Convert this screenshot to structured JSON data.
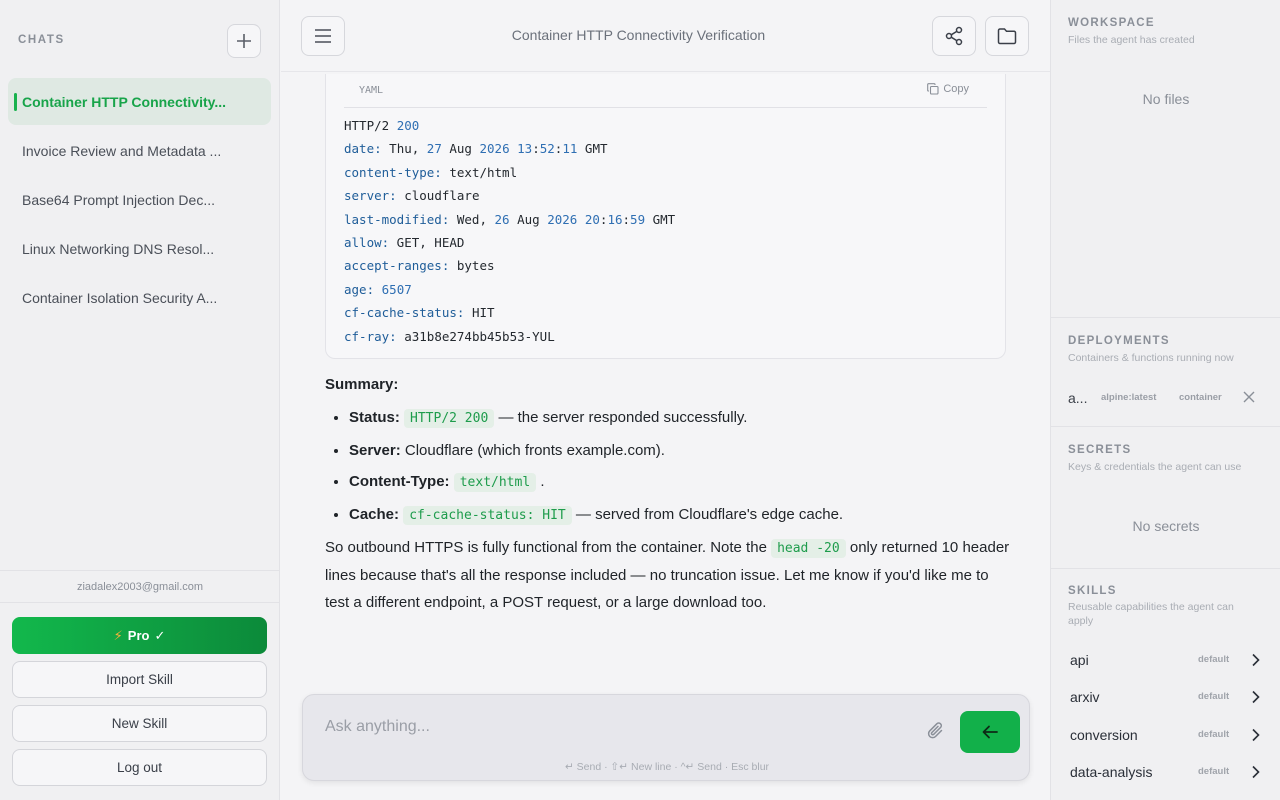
{
  "sidebar": {
    "heading": "CHATS",
    "chats": [
      {
        "label": "Container HTTP Connectivity...",
        "active": true
      },
      {
        "label": "Invoice Review and Metadata ...",
        "active": false
      },
      {
        "label": "Base64 Prompt Injection Dec...",
        "active": false
      },
      {
        "label": "Linux Networking DNS Resol...",
        "active": false
      },
      {
        "label": "Container Isolation Security A...",
        "active": false
      }
    ],
    "email": "ziadalex2003@gmail.com",
    "pro_label": "Pro",
    "pro_check": "✓",
    "import_label": "Import Skill",
    "new_skill_label": "New Skill",
    "logout_label": "Log out"
  },
  "header": {
    "title": "Container HTTP Connectivity Verification"
  },
  "code": {
    "lang": "YAML",
    "copy_label": "Copy",
    "lines": [
      "HTTP/2 200",
      "date: Thu, 27 Aug 2026 13:52:11 GMT",
      "content-type: text/html",
      "server: cloudflare",
      "last-modified: Wed, 26 Aug 2026 20:16:59 GMT",
      "allow: GET, HEAD",
      "accept-ranges: bytes",
      "age: 6507",
      "cf-cache-status: HIT",
      "cf-ray: a31b8e274bb45b53-YUL"
    ]
  },
  "answer": {
    "summary_heading": "Summary:",
    "bullets": [
      {
        "label": "Status:",
        "code": "HTTP/2 200",
        "text": " — the server responded successfully."
      },
      {
        "label": "Server:",
        "code": "",
        "text": " Cloudflare (which fronts example.com)."
      },
      {
        "label": "Content-Type:",
        "code": "text/html",
        "text": " ."
      },
      {
        "label": "Cache:",
        "code": "cf-cache-status: HIT",
        "text": " — served from Cloudflare's edge cache."
      }
    ],
    "para_before": "So outbound HTTPS is fully functional from the container. Note the ",
    "para_code": "head -20",
    "para_after": " only returned 10 header lines because that's all the response included — no truncation issue. Let me know if you'd like me to test a different endpoint, a POST request, or a large download too."
  },
  "composer": {
    "placeholder": "Ask anything...",
    "hints": "↵ Send · ⇧↵ New line · ^↵ Send · Esc blur"
  },
  "right": {
    "workspace": {
      "title": "WORKSPACE",
      "subtitle": "Files the agent has created",
      "empty": "No files"
    },
    "deployments": {
      "title": "DEPLOYMENTS",
      "subtitle": "Containers & functions running now",
      "items": [
        {
          "name": "a...",
          "image": "alpine:latest",
          "type": "container"
        }
      ]
    },
    "secrets": {
      "title": "SECRETS",
      "subtitle": "Keys & credentials the agent can use",
      "empty": "No secrets"
    },
    "skills": {
      "title": "SKILLS",
      "subtitle": "Reusable capabilities the agent can apply",
      "items": [
        {
          "name": "api",
          "tag": "default"
        },
        {
          "name": "arxiv",
          "tag": "default"
        },
        {
          "name": "conversion",
          "tag": "default"
        },
        {
          "name": "data-analysis",
          "tag": "default"
        }
      ]
    }
  },
  "colors": {
    "accent": "#12b04a",
    "accent_text": "#18a44a"
  }
}
